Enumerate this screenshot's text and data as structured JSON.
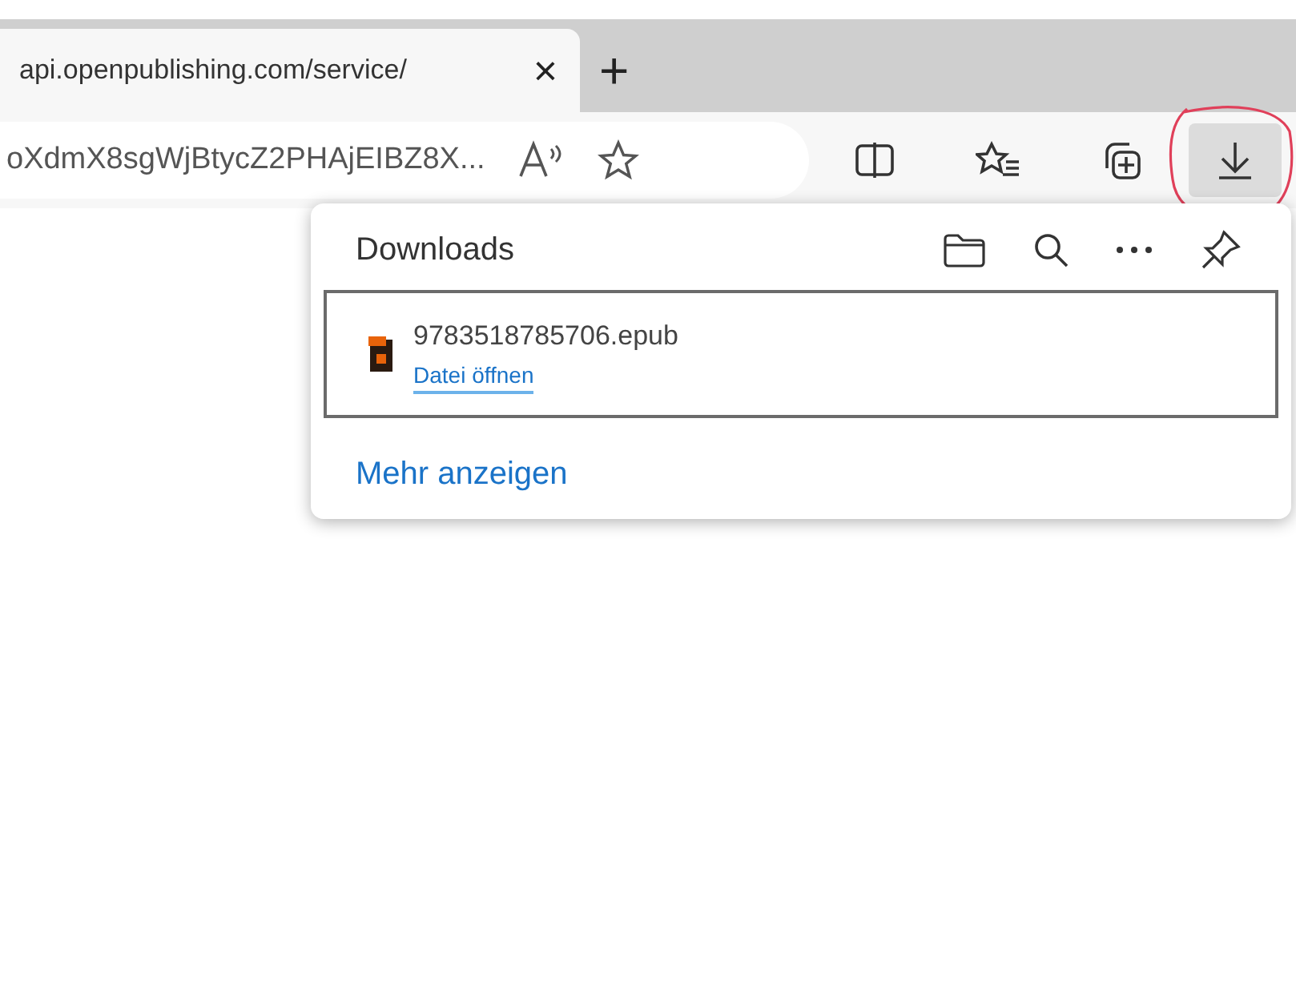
{
  "tab": {
    "title": "api.openpublishing.com/service/",
    "close": "×",
    "new_tab": "+"
  },
  "address_bar": {
    "value": "oXdmX8sgWjBtycZ2PHAjEIBZ8X..."
  },
  "toolbar": {
    "download_button": {
      "selected": true
    }
  },
  "downloads_panel": {
    "title": "Downloads",
    "items": [
      {
        "file_name": "9783518785706.epub",
        "action": "Datei öffnen"
      }
    ],
    "more_link": "Mehr anzeigen"
  }
}
